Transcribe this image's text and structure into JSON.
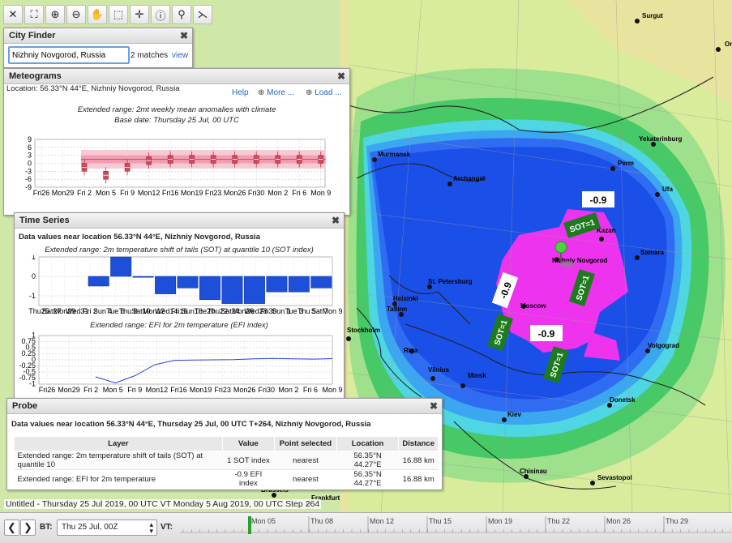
{
  "map": {
    "cities": [
      {
        "name": "Surgut"
      },
      {
        "name": "Omsk"
      },
      {
        "name": "Yekaterinburg"
      },
      {
        "name": "Perm"
      },
      {
        "name": "Ufa"
      },
      {
        "name": "Murmansk"
      },
      {
        "name": "Archangel"
      },
      {
        "name": "Kazan"
      },
      {
        "name": "Samara"
      },
      {
        "name": "Nizhniy Novgorod"
      },
      {
        "name": "St. Petersburg"
      },
      {
        "name": "Helsinki"
      },
      {
        "name": "Tallinn"
      },
      {
        "name": "Moscow"
      },
      {
        "name": "Stockholm"
      },
      {
        "name": "Riga"
      },
      {
        "name": "Vilnius"
      },
      {
        "name": "Minsk"
      },
      {
        "name": "Volgograd"
      },
      {
        "name": "Kiev"
      },
      {
        "name": "Donetsk"
      },
      {
        "name": "Chisinau"
      },
      {
        "name": "Sevastopol"
      },
      {
        "name": "Brussels"
      },
      {
        "name": "Frankfurt"
      }
    ],
    "labels": {
      "m09a": "-0.9",
      "m09b": "-0.9",
      "m09c": "-0.9",
      "sot1": "SOT=1",
      "sot2": "SOT=1",
      "sot3": "SOT=1",
      "sot4": "SOT=1"
    }
  },
  "cityFinder": {
    "title": "City Finder",
    "query": "Nizhniy Novgorod, Russia",
    "matches": "2 matches",
    "view": "view"
  },
  "meteograms": {
    "title": "Meteograms",
    "location": "Location: 56.33°N 44°E, Nizhniy Novgorod, Russia",
    "help": "Help",
    "more": "More ...",
    "load": "Load ...",
    "chartTitle": "Extended range: 2mt weekly mean anomalies with climate",
    "chartSub": "Base date: Thursday 25 Jul, 00 UTC",
    "chart_data": {
      "type": "box",
      "categories": [
        "Fri 2",
        "Mon 5",
        "Fri 9",
        "Mon 12",
        "Fri 16",
        "Mon 19",
        "Fri 23",
        "Mon 26",
        "Fri 30",
        "Mon 2",
        "Fri 6",
        "Mon 9"
      ],
      "xticks": [
        "Fri26",
        "Mon29",
        "Fri 2",
        "Mon 5",
        "Fri 9",
        "Mon12",
        "Fri16",
        "Mon19",
        "Fri23",
        "Mon26",
        "Fri30",
        "Mon 2",
        "Fri 6",
        "Mon 9"
      ],
      "yticks": [
        "9",
        "6",
        "3",
        "0",
        "-3",
        "-6",
        "-9"
      ],
      "ylim": [
        -9,
        9
      ],
      "medians": [
        -1.5,
        -4.5,
        -1.5,
        1,
        1.5,
        1.5,
        1.5,
        1.5,
        1.5,
        1.5,
        1.5,
        1.5
      ]
    }
  },
  "timeSeries": {
    "title": "Time Series",
    "heading": "Data values near location 56.33°N 44°E, Nizhniy Novgorod, Russia",
    "chart1": {
      "title": "Extended range: 2m temperature shift of tails (SOT) at quantile 10 (SOT index)",
      "type": "bar",
      "yticks": [
        "1",
        "0",
        "-1"
      ],
      "ylim": [
        -1.5,
        1
      ],
      "values": [
        -0.5,
        1,
        -0.05,
        -0.9,
        -0.6,
        -1.2,
        -1.4,
        -1.4,
        -0.8,
        -0.8,
        -0.6
      ],
      "xticks": [
        "Thu25",
        "Sat27",
        "Mon29",
        "Wed31",
        "Fri 2",
        "Sun 4",
        "Tue 6",
        "Thu 8",
        "Sat10",
        "Mon12",
        "Wed14",
        "Fri16",
        "Sun18",
        "Tue20",
        "Thu22",
        "Sat24",
        "Mon26",
        "Wed28",
        "Fri30",
        "Sun 1",
        "Tue 3",
        "Thu 5",
        "Sat 7",
        "Mon 9"
      ]
    },
    "chart2": {
      "title": "Extended range: EFI for 2m temperature (EFI index)",
      "type": "line",
      "yticks": [
        "1",
        "0.75",
        "0.5",
        "0.25",
        "0",
        "-0.25",
        "-0.5",
        "-0.75",
        "-1"
      ],
      "ylim": [
        -1,
        1
      ],
      "values": [
        -0.7,
        -0.95,
        -0.65,
        -0.2,
        -0.02,
        -0.01,
        0,
        0.01,
        0.04,
        0.06,
        0.04,
        0.03,
        0.05
      ],
      "xticks": [
        "Fri26",
        "Mon29",
        "Fri 2",
        "Mon 5",
        "Fri 9",
        "Mon12",
        "Fri16",
        "Mon19",
        "Fri23",
        "Mon26",
        "Fri30",
        "Mon 2",
        "Fri 6",
        "Mon 9"
      ]
    }
  },
  "probe": {
    "title": "Probe",
    "heading": "Data values near location 56.33°N 44°E, Thursday 25 Jul, 00 UTC T+264, Nizhniy Novgorod, Russia",
    "columns": [
      "Layer",
      "Value",
      "Point selected",
      "Location",
      "Distance"
    ],
    "rows": [
      [
        "Extended range: 2m temperature shift of tails (SOT) at quantile 10",
        "1 SOT index",
        "nearest",
        "56.35°N 44.27°E",
        "16.88 km"
      ],
      [
        "Extended range: EFI for 2m temperature",
        "-0.9 EFI index",
        "nearest",
        "56.35°N 44.27°E",
        "16.88 km"
      ]
    ]
  },
  "status": "Untitled - Thursday 25 Jul 2019, 00 UTC VT Monday 5 Aug 2019, 00 UTC Step 264",
  "timebar": {
    "bt": "BT:",
    "btValue": "Thu 25 Jul, 00Z",
    "vt": "VT:",
    "ticks": [
      "Mon 05",
      "Thu 08",
      "Mon 12",
      "Thu 15",
      "Mon 19",
      "Thu 22",
      "Mon 26",
      "Thu 29"
    ]
  },
  "colors": {
    "magenta": "#ee33ee",
    "deepBlue": "#1a4fe8",
    "blue": "#2f6cf2",
    "lightBlue": "#3aa7f0",
    "cyan": "#4fd6e3",
    "green": "#48c968",
    "lightGreen": "#9fe08c"
  }
}
